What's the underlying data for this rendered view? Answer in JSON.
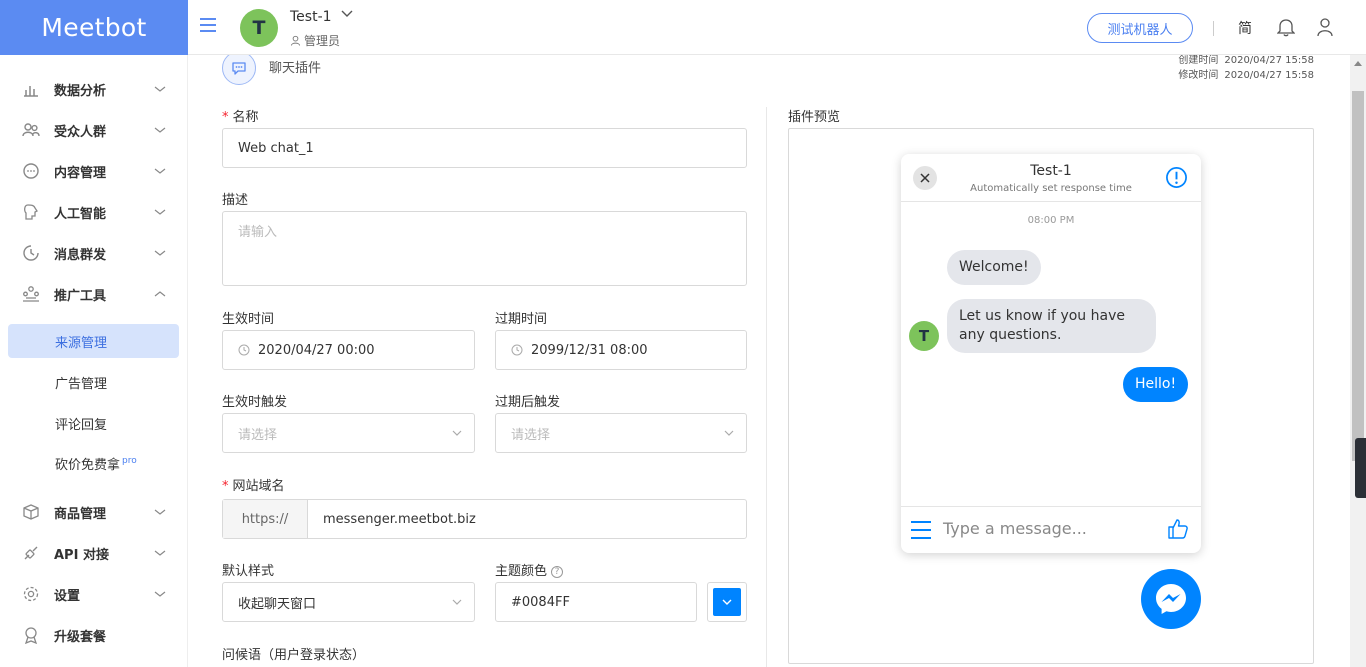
{
  "app": {
    "logo": "Meetbot"
  },
  "topbar": {
    "account_name": "Test-1",
    "account_initial": "T",
    "account_role": "管理员",
    "test_bot_label": "测试机器人",
    "lang_label": "简"
  },
  "sidebar": {
    "items": [
      {
        "label": "数据分析",
        "icon": "chart-icon"
      },
      {
        "label": "受众人群",
        "icon": "users-icon"
      },
      {
        "label": "内容管理",
        "icon": "message-icon"
      },
      {
        "label": "人工智能",
        "icon": "ai-icon"
      },
      {
        "label": "消息群发",
        "icon": "broadcast-icon"
      },
      {
        "label": "推广工具",
        "icon": "promote-icon"
      },
      {
        "label": "商品管理",
        "icon": "box-icon"
      },
      {
        "label": "API 对接",
        "icon": "api-icon"
      },
      {
        "label": "设置",
        "icon": "gear-icon"
      },
      {
        "label": "升级套餐",
        "icon": "upgrade-icon"
      }
    ],
    "sub_items": [
      {
        "label": "来源管理"
      },
      {
        "label": "广告管理"
      },
      {
        "label": "评论回复"
      },
      {
        "label": "砍价免费拿",
        "badge": "pro"
      }
    ]
  },
  "page": {
    "plugin_type": "聊天插件",
    "created_label": "创建时间",
    "created_value": "2020/04/27 15:58",
    "modified_label": "修改时间",
    "modified_value": "2020/04/27 15:58"
  },
  "form": {
    "name_label": "名称",
    "name_value": "Web chat_1",
    "desc_label": "描述",
    "desc_placeholder": "请输入",
    "start_label": "生效时间",
    "start_value": "2020/04/27 00:00",
    "end_label": "过期时间",
    "end_value": "2099/12/31 08:00",
    "trigger_start_label": "生效时触发",
    "trigger_end_label": "过期后触发",
    "select_placeholder": "请选择",
    "domain_label": "网站域名",
    "domain_prefix": "https://",
    "domain_value": "messenger.meetbot.biz",
    "style_label": "默认样式",
    "style_value": "收起聊天窗口",
    "theme_label": "主题颜色",
    "theme_value": "#0084FF",
    "greeting_label": "问候语（用户登录状态）"
  },
  "preview": {
    "label": "插件预览",
    "title": "Test-1",
    "subtitle": "Automatically set response time",
    "time": "08:00 PM",
    "avatar_initial": "T",
    "msg_welcome": "Welcome!",
    "msg_question": "Let us know if you have any questions.",
    "msg_reply": "Hello!",
    "input_placeholder": "Type a message...",
    "accent_color": "#0084ff"
  }
}
